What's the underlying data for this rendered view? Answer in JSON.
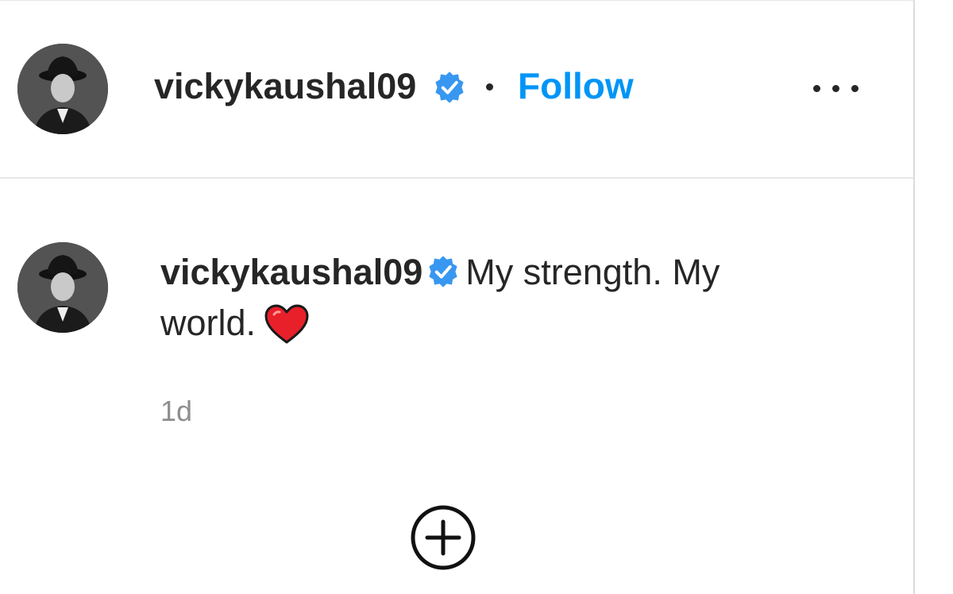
{
  "post_header": {
    "username": "vickykaushal09",
    "separator": "•",
    "follow_label": "Follow",
    "more_icon": "more-options-icon"
  },
  "caption": {
    "username": "vickykaushal09",
    "text": "My strength. My world.",
    "emoji": "red-heart-icon"
  },
  "timestamp": "1d",
  "add_comment_icon": "plus-circle-icon",
  "colors": {
    "accent": "#0095f6",
    "verified": "#3897f0",
    "text": "#262626",
    "muted": "#8e8e8e",
    "heart": "#e8202a"
  }
}
